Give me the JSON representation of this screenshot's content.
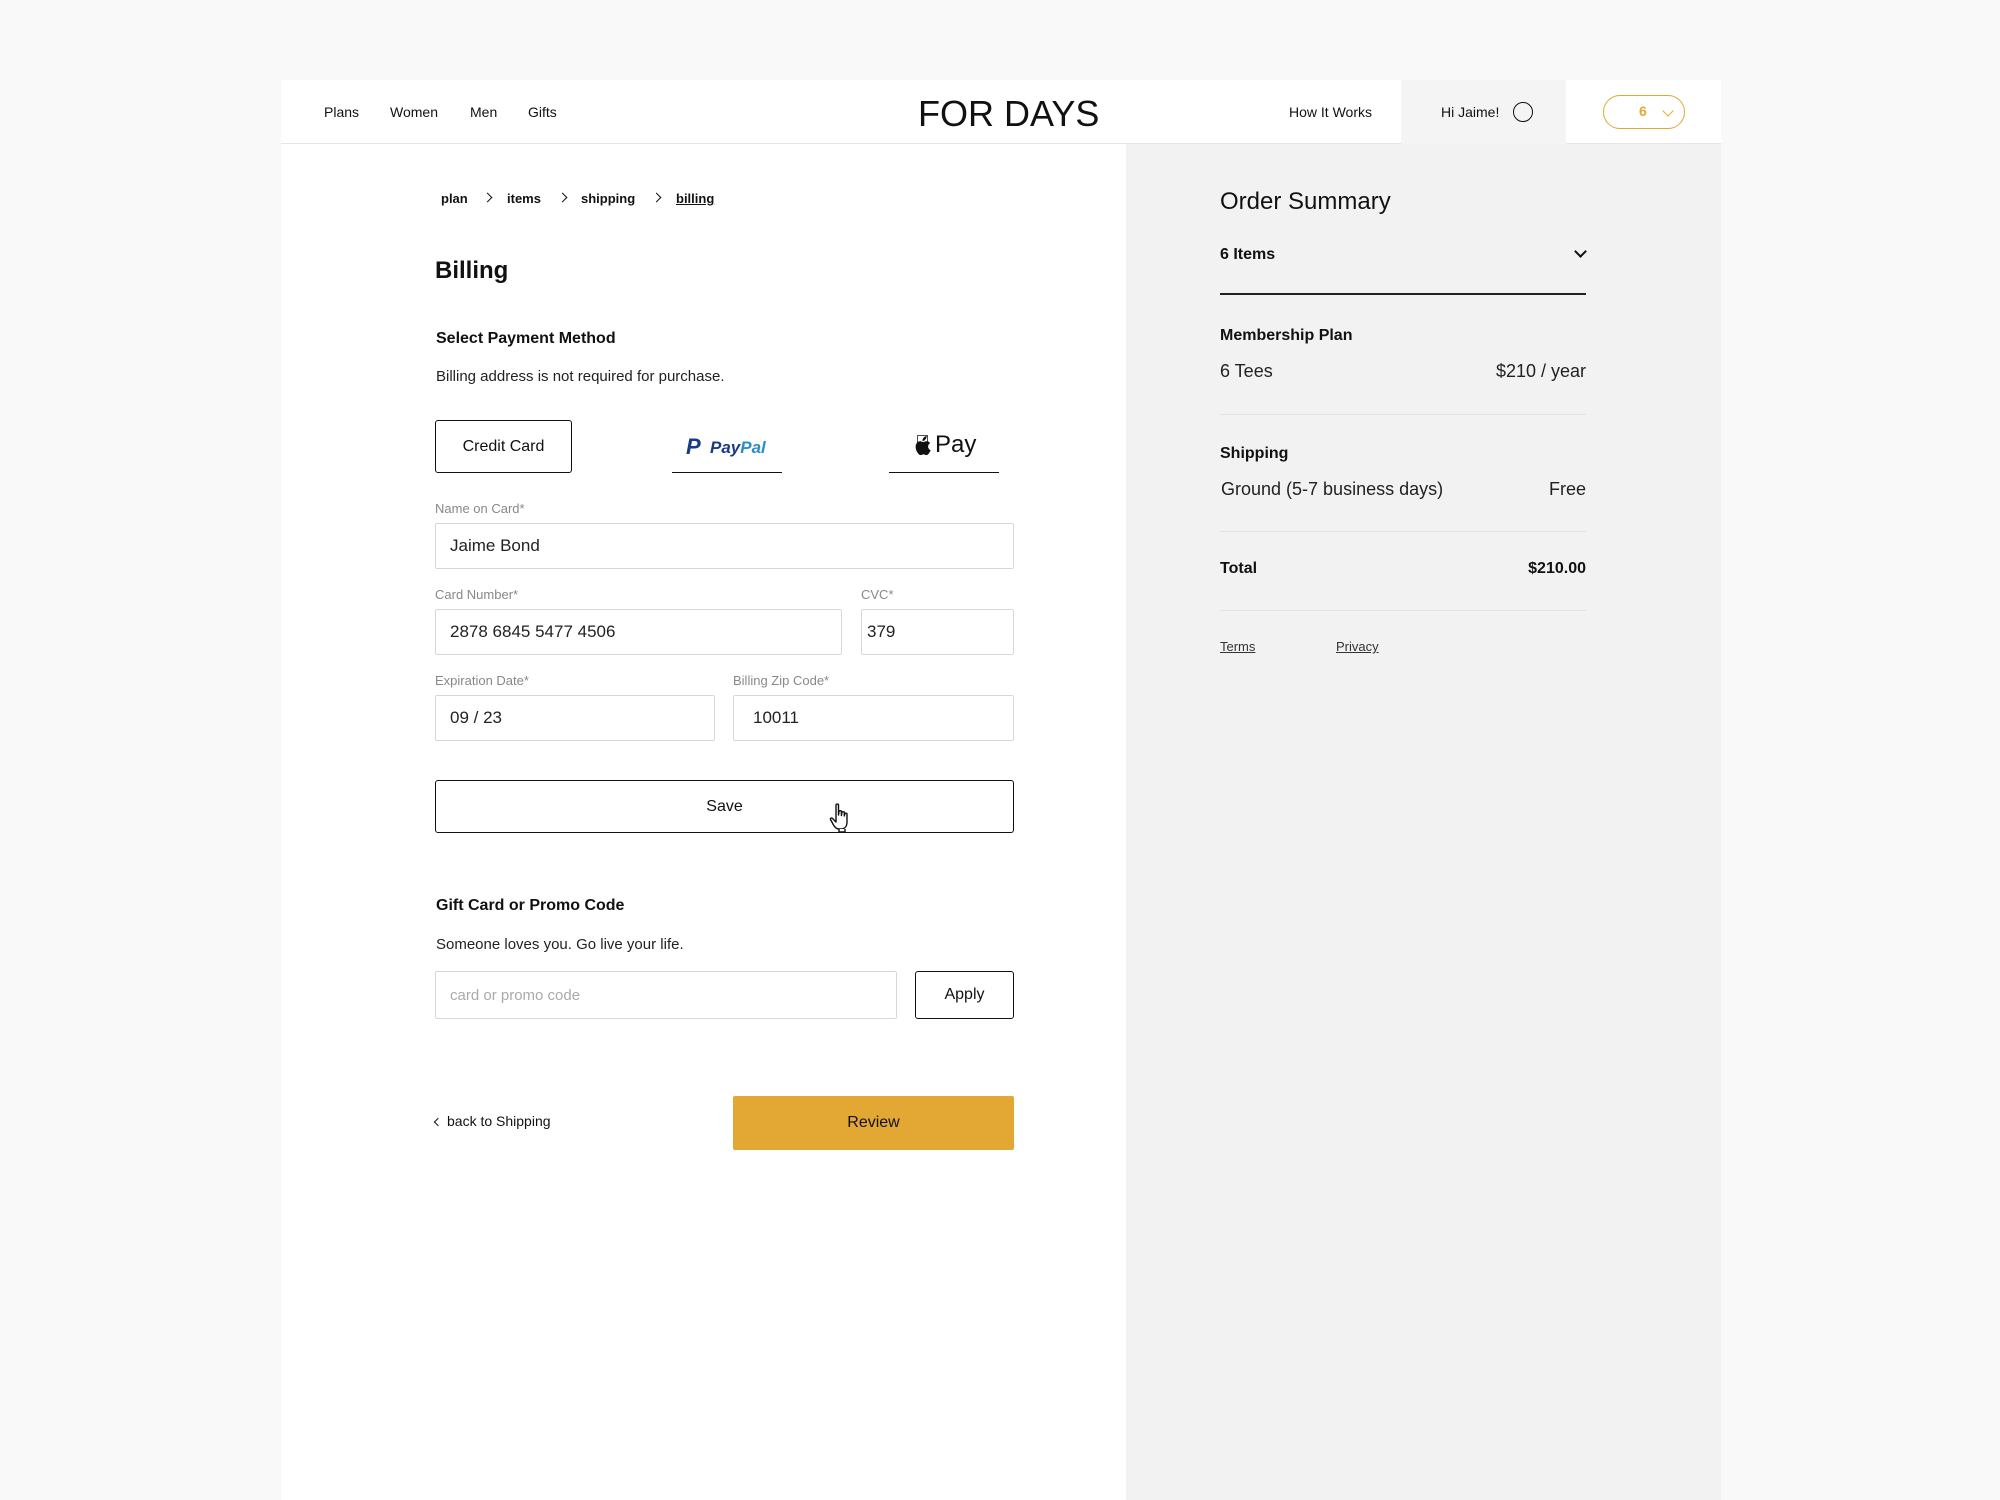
{
  "header": {
    "nav": [
      "Plans",
      "Women",
      "Men",
      "Gifts"
    ],
    "logo": "FOR DAYS",
    "how_it_works": "How It Works",
    "greeting": "Hi Jaime!",
    "cart_count": "6",
    "accent_color": "#e3a733"
  },
  "breadcrumb": [
    "plan",
    "items",
    "shipping",
    "billing"
  ],
  "billing": {
    "title": "Billing",
    "payment_heading": "Select Payment Method",
    "payment_note": "Billing address is not required for purchase.",
    "methods": {
      "credit": "Credit Card",
      "paypal_a": "Pay",
      "paypal_b": "Pal",
      "apple": "Pay"
    },
    "fields": {
      "name_label": "Name on Card*",
      "name_value": "Jaime Bond",
      "card_label": "Card Number*",
      "card_value": "2878 6845 5477 4506",
      "cvc_label": "CVC*",
      "cvc_value": "379",
      "exp_label": "Expiration Date*",
      "exp_value": "09 / 23",
      "zip_label": "Billing Zip Code*",
      "zip_value": "10011"
    },
    "save_label": "Save"
  },
  "promo": {
    "heading": "Gift Card or Promo Code",
    "note": "Someone loves you. Go live your life.",
    "placeholder": "card or promo code",
    "apply_label": "Apply"
  },
  "footer_nav": {
    "back_label": "back to Shipping",
    "review_label": "Review"
  },
  "summary": {
    "title": "Order Summary",
    "items_label": "6 Items",
    "plan_heading": "Membership Plan",
    "plan_name": "6 Tees",
    "plan_price": "$210 / year",
    "shipping_heading": "Shipping",
    "shipping_method": "Ground (5-7 business days)",
    "shipping_price": "Free",
    "total_label": "Total",
    "total_value": "$210.00",
    "terms": "Terms",
    "privacy": "Privacy"
  }
}
